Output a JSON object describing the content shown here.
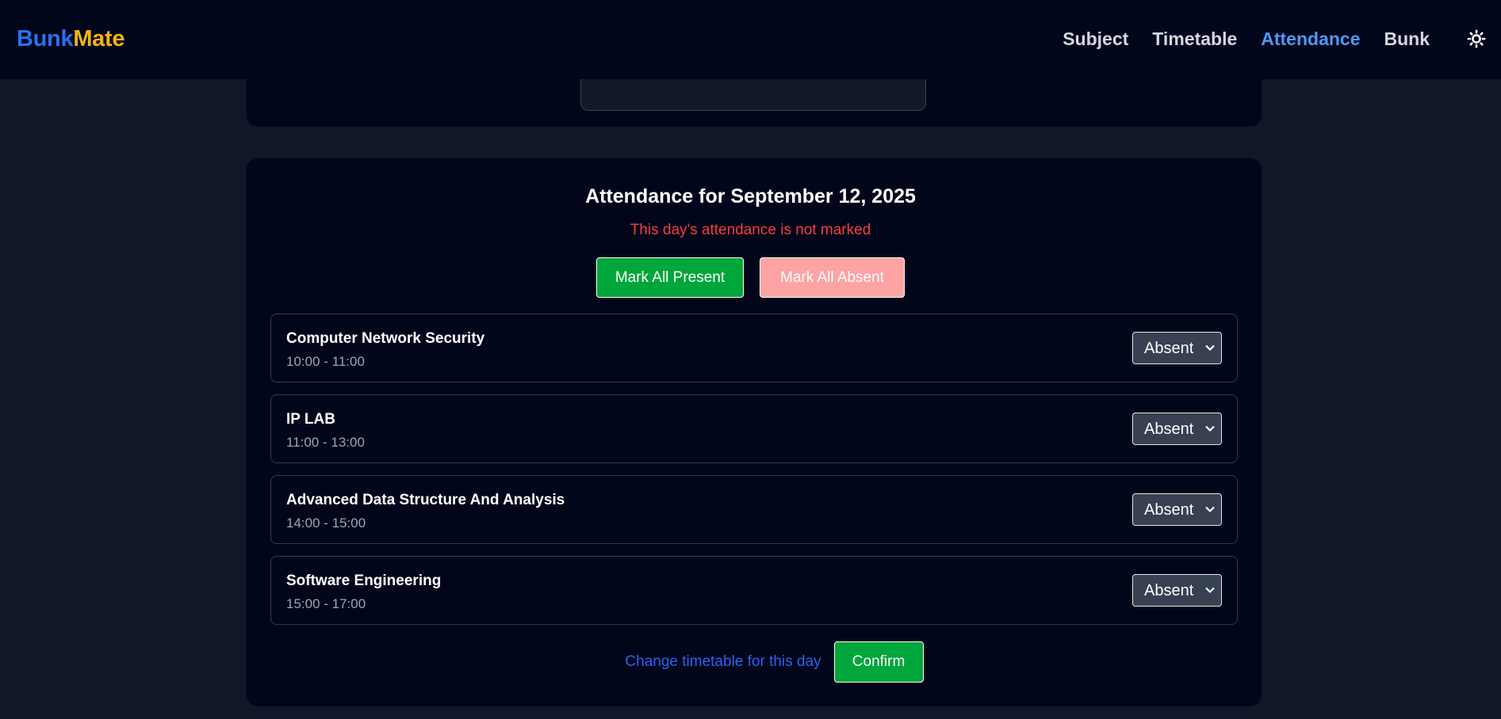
{
  "brand": {
    "part1": "Bunk",
    "part2": "Mate"
  },
  "nav": {
    "items": [
      {
        "label": "Subject",
        "active": false
      },
      {
        "label": "Timetable",
        "active": false
      },
      {
        "label": "Attendance",
        "active": true
      },
      {
        "label": "Bunk",
        "active": false
      }
    ],
    "theme_icon": "sun-icon"
  },
  "attendance": {
    "title": "Attendance for September 12, 2025",
    "status_message": "This day's attendance is not marked",
    "mark_all_present_label": "Mark All Present",
    "mark_all_absent_label": "Mark All Absent",
    "subjects": [
      {
        "name": "Computer Network Security",
        "time": "10:00 - 11:00",
        "status": "Absent"
      },
      {
        "name": "IP LAB",
        "time": "11:00 - 13:00",
        "status": "Absent"
      },
      {
        "name": "Advanced Data Structure And Analysis",
        "time": "14:00 - 15:00",
        "status": "Absent"
      },
      {
        "name": "Software Engineering",
        "time": "15:00 - 17:00",
        "status": "Absent"
      }
    ],
    "change_timetable_label": "Change timetable for this day",
    "confirm_label": "Confirm"
  },
  "colors": {
    "accent_blue": "#4f98f6",
    "brand_blue": "#2a6ff0",
    "brand_yellow": "#f3b316",
    "present_green": "#00a63b",
    "absent_pink": "#fea3a3",
    "warning_red": "#f43e3e",
    "link_blue": "#2962f4"
  }
}
